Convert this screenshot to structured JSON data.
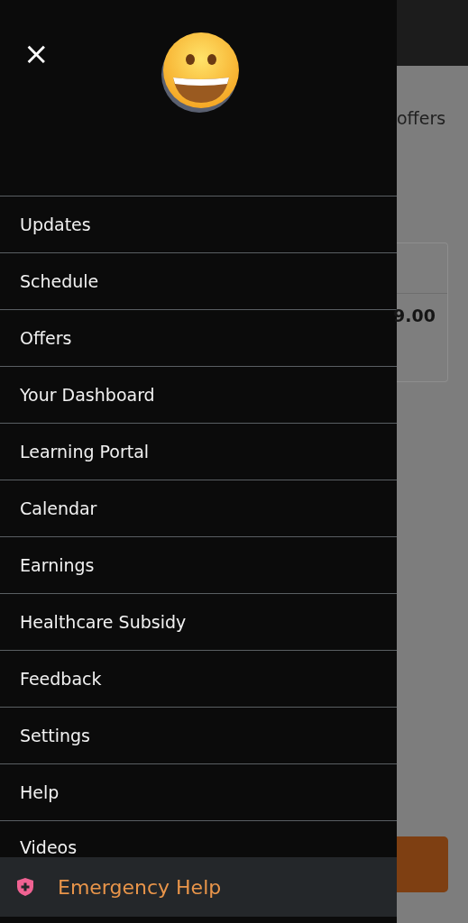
{
  "drawer": {
    "close_icon": "×",
    "items": [
      {
        "label": "Updates"
      },
      {
        "label": "Schedule"
      },
      {
        "label": "Offers"
      },
      {
        "label": "Your Dashboard"
      },
      {
        "label": "Learning Portal"
      },
      {
        "label": "Calendar"
      },
      {
        "label": "Earnings"
      },
      {
        "label": "Healthcare Subsidy"
      },
      {
        "label": "Feedback"
      },
      {
        "label": "Settings"
      },
      {
        "label": "Help"
      },
      {
        "label": "Videos"
      }
    ],
    "emergency": {
      "label": "Emergency Help"
    }
  },
  "background": {
    "heading": "offers",
    "amount": "9.00"
  }
}
